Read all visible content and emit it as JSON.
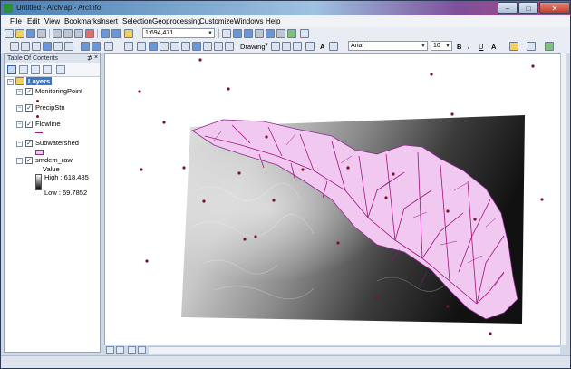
{
  "window": {
    "title": "Untitled - ArcMap - ArcInfo",
    "minimize": "–",
    "maximize": "□",
    "close": "✕"
  },
  "menu": [
    "File",
    "Edit",
    "View",
    "Bookmarks",
    "Insert",
    "Selection",
    "Geoprocessing",
    "Customize",
    "Windows",
    "Help"
  ],
  "toolbar": {
    "scale": "1:694,471",
    "drawing_label": "Drawing",
    "font_name": "Arial",
    "font_size": "10",
    "bold": "B",
    "italic": "I",
    "underline": "U",
    "text_tool": "A",
    "font_color": "A"
  },
  "toc": {
    "title": "Table Of Contents",
    "pin": "⊅",
    "close": "×",
    "group": "Layers",
    "layers": [
      {
        "name": "MonitoringPoint",
        "checked": true
      },
      {
        "name": "PrecipStn",
        "checked": true
      },
      {
        "name": "Flowline",
        "checked": true
      },
      {
        "name": "Subwatershed",
        "checked": true
      },
      {
        "name": "smdem_raw",
        "checked": true
      }
    ],
    "raster_value_label": "Value",
    "raster_high": "High : 618.485",
    "raster_low": "Low : 69.7852"
  },
  "colors": {
    "point": "#7a1228",
    "flowline": "#a3137d",
    "subwatershed_fill": "#f0c8f0",
    "subwatershed_outline": "#8e2a8e"
  }
}
